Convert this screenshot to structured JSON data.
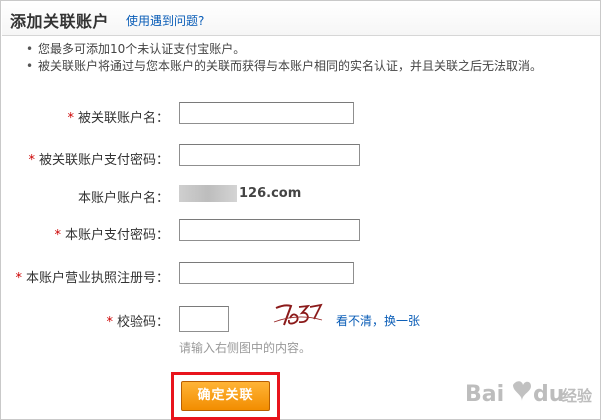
{
  "header": {
    "title": "添加关联账户",
    "help_link": "使用遇到问题?"
  },
  "tips": [
    "您最多可添加10个未认证支付宝账户。",
    "被关联账户将通过与您本账户的关联而获得与本账户相同的实名认证，并且关联之后无法取消。"
  ],
  "form": {
    "required_marker": "*",
    "linked_account_name": {
      "label": "被关联账户名：",
      "value": ""
    },
    "linked_account_pay_password": {
      "label": "被关联账户支付密码：",
      "value": ""
    },
    "this_account_name": {
      "label": "本账户账户名：",
      "value_suffix": "126.com"
    },
    "this_account_pay_password": {
      "label": "本账户支付密码：",
      "value": ""
    },
    "business_license_number": {
      "label": "本账户营业执照注册号：",
      "value": ""
    },
    "captcha": {
      "label": "校验码：",
      "value": "",
      "image_text": "7o57",
      "refresh_link": "看不清，换一张",
      "hint": "请输入右侧图中的内容。"
    }
  },
  "actions": {
    "confirm_label": "确定关联"
  },
  "watermark": {
    "text": "Bai du 经验",
    "colors": {
      "primary": "#a7a7a7"
    }
  },
  "colors": {
    "link": "#0a5db7",
    "required": "#cc0000",
    "button": "#f28d00",
    "highlight_box": "#e8141c"
  }
}
